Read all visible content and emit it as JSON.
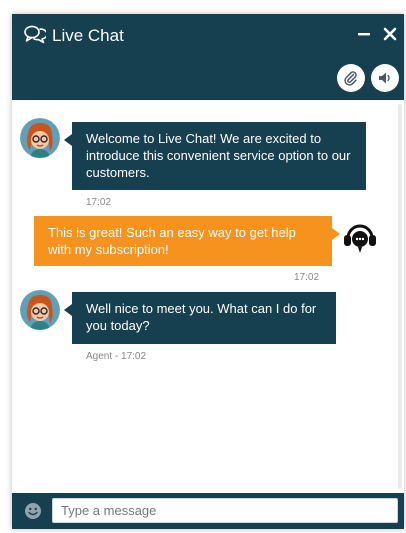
{
  "header": {
    "title": "Live Chat",
    "icons": {
      "chat": "chat-bubbles-icon",
      "minimize": "minus-icon",
      "close": "close-icon",
      "attach": "paperclip-icon",
      "sound": "speaker-icon"
    }
  },
  "messages": [
    {
      "sender": "agent",
      "text": "Welcome to Live Chat! We are excited to introduce this convenient service option to our customers.",
      "time": "17:02"
    },
    {
      "sender": "user",
      "text": "This is great! Such an easy way to get help with my subscription!",
      "time": "17:02"
    },
    {
      "sender": "agent",
      "text": "Well nice to meet you. What can I do for you today?",
      "time": "Agent - 17:02"
    }
  ],
  "composer": {
    "placeholder": "Type a message",
    "emoji_icon": "smiley-icon"
  },
  "colors": {
    "brand": "#163f4f",
    "user_bubble": "#f6931e",
    "timestamp": "#888888"
  }
}
